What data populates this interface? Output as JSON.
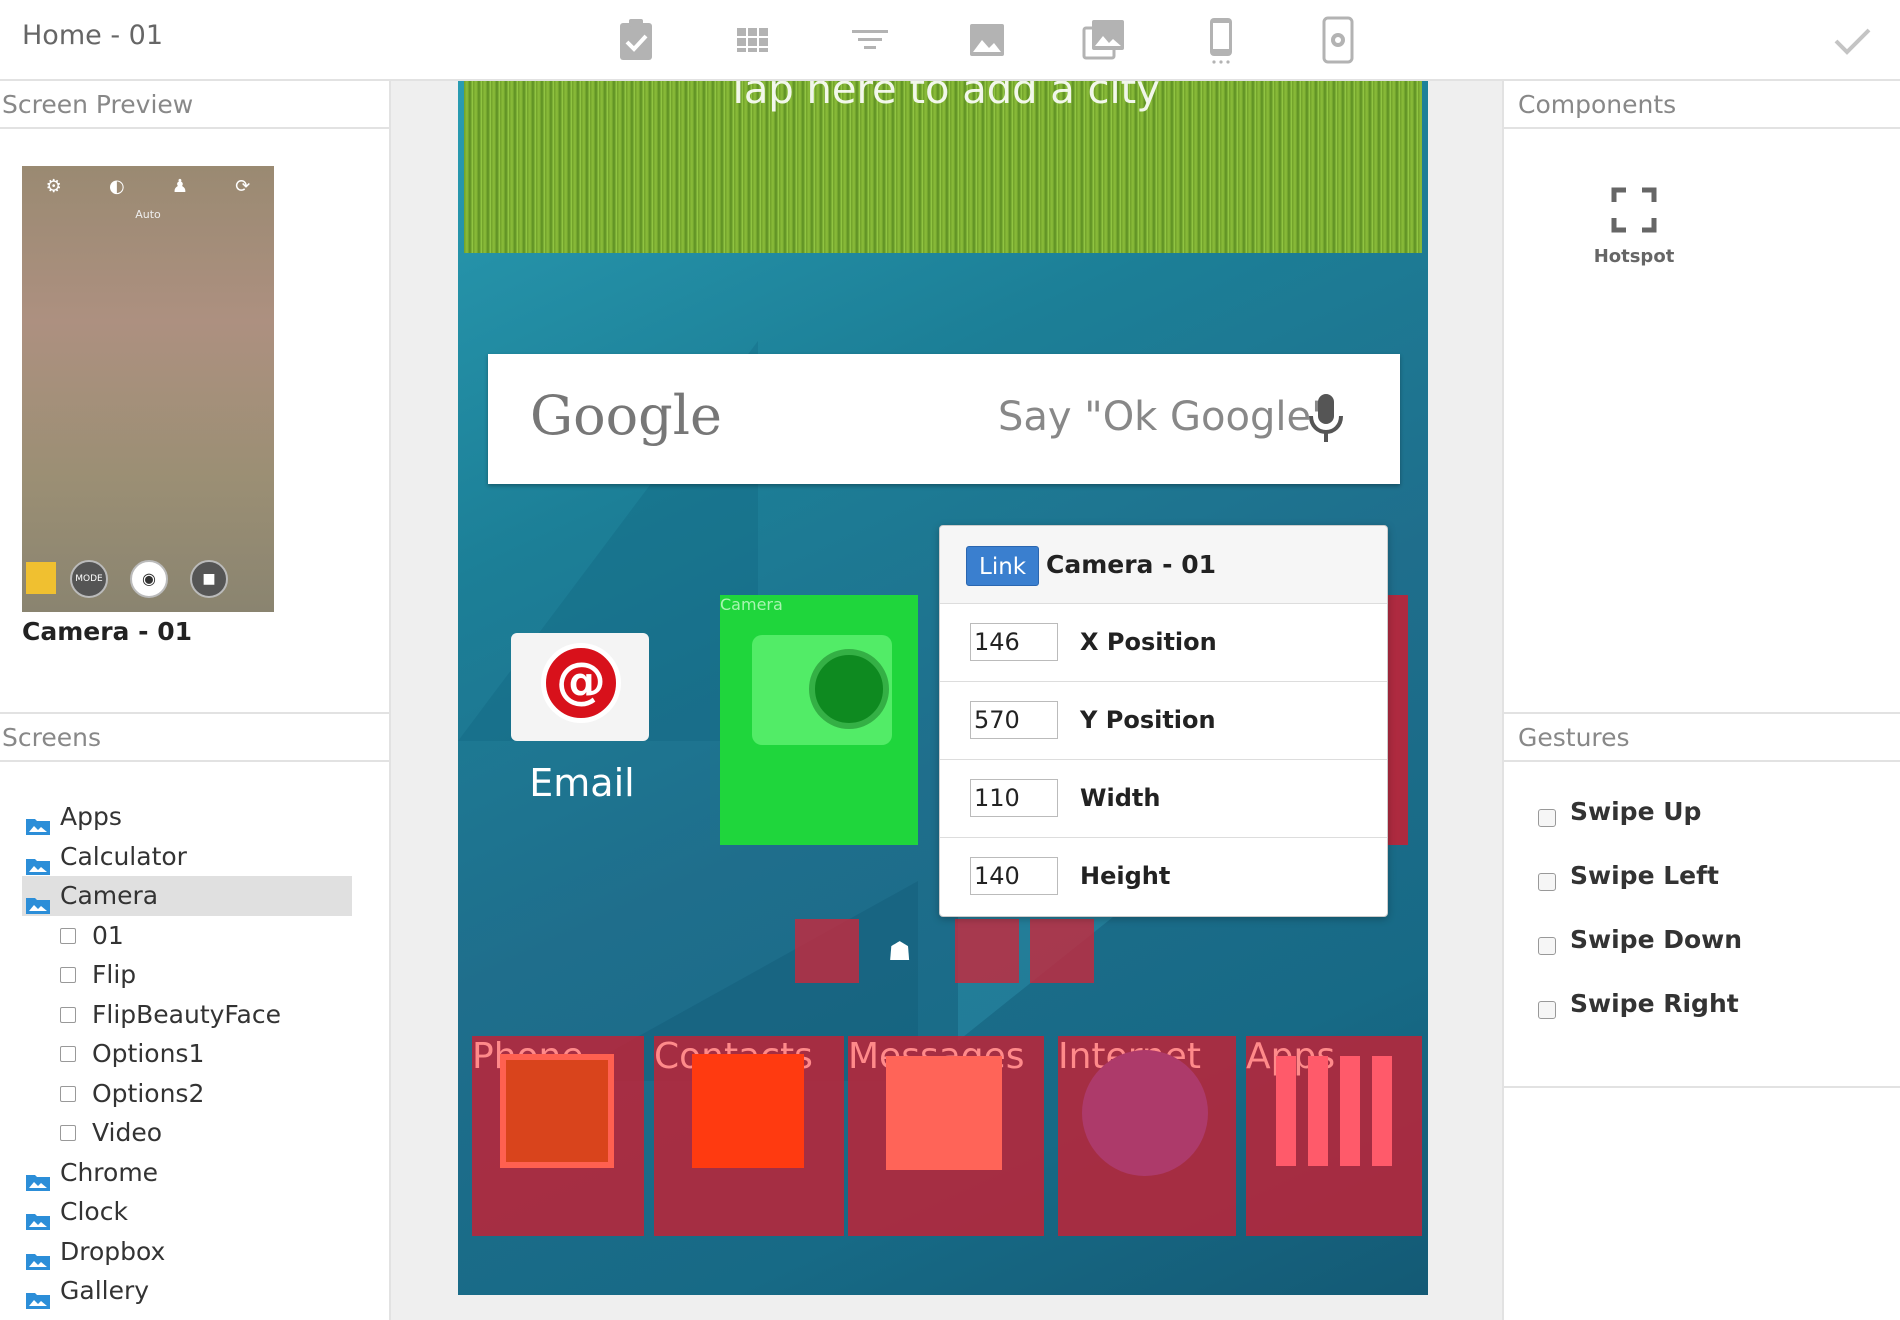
{
  "window": {
    "title": "Home - 01"
  },
  "toolbar": {
    "icons": [
      "clipboard-check-icon",
      "grid-icon",
      "filter-icon",
      "image-icon",
      "images-icon",
      "phone-icon",
      "phone-settings-icon"
    ],
    "done_icon": "check-icon"
  },
  "left": {
    "preview_header": "Screen Preview",
    "preview_name": "Camera - 01",
    "preview_auto": "Auto",
    "preview_mode": "MODE",
    "screens_header": "Screens",
    "tree": [
      {
        "label": "Apps",
        "type": "folder"
      },
      {
        "label": "Calculator",
        "type": "folder"
      },
      {
        "label": "Camera",
        "type": "folder",
        "selected": true
      },
      {
        "label": "01",
        "type": "screen"
      },
      {
        "label": "Flip",
        "type": "screen"
      },
      {
        "label": "FlipBeautyFace",
        "type": "screen"
      },
      {
        "label": "Options1",
        "type": "screen"
      },
      {
        "label": "Options2",
        "type": "screen"
      },
      {
        "label": "Video",
        "type": "screen"
      },
      {
        "label": "Chrome",
        "type": "folder"
      },
      {
        "label": "Clock",
        "type": "folder"
      },
      {
        "label": "Dropbox",
        "type": "folder"
      },
      {
        "label": "Gallery",
        "type": "folder"
      }
    ]
  },
  "right": {
    "components_header": "Components",
    "hotspot_label": "Hotspot",
    "gestures_header": "Gestures",
    "gestures": [
      {
        "label": "Swipe Up",
        "checked": false
      },
      {
        "label": "Swipe Left",
        "checked": false
      },
      {
        "label": "Swipe Down",
        "checked": false
      },
      {
        "label": "Swipe Right",
        "checked": false
      }
    ]
  },
  "phone": {
    "banner_text": "Tap here to add a city",
    "search_logo": "Google",
    "search_hint": "Say \"Ok Google\"",
    "apps": {
      "email": "Email",
      "camera": "Camera"
    },
    "dock": [
      "Phone",
      "Contacts",
      "Messages",
      "Internet",
      "Apps"
    ]
  },
  "popover": {
    "badge": "Link",
    "title": "Camera - 01",
    "fields": [
      {
        "label": "X Position",
        "value": "146"
      },
      {
        "label": "Y Position",
        "value": "570"
      },
      {
        "label": "Width",
        "value": "110"
      },
      {
        "label": "Height",
        "value": "140"
      }
    ]
  },
  "colors": {
    "accent": "#3a7fcf",
    "hotspot_green": "#1fd63c",
    "hotspot_red": "#be2337"
  }
}
